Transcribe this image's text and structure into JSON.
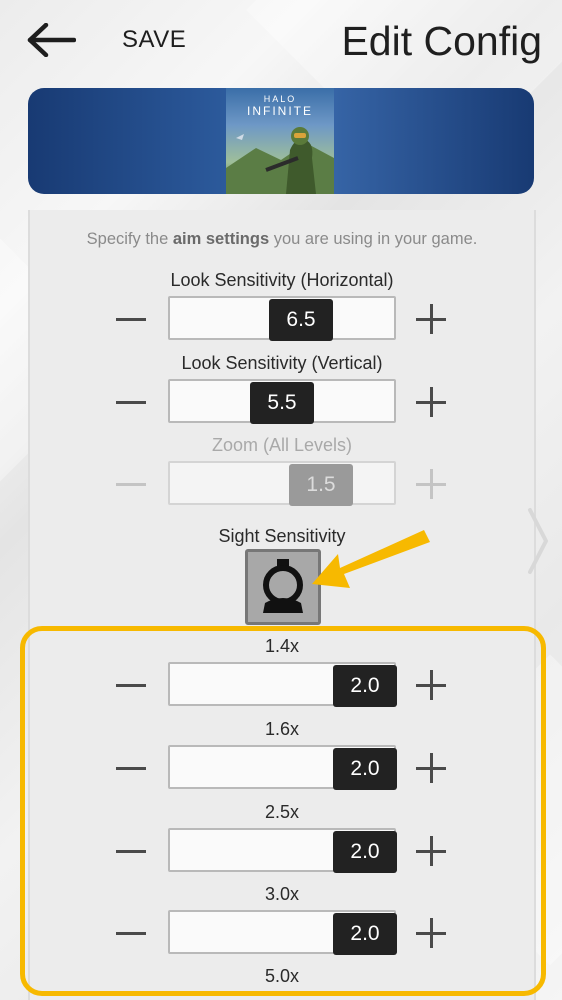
{
  "header": {
    "save_label": "SAVE",
    "title": "Edit Config"
  },
  "banner": {
    "cover_logo": "HALO",
    "cover_subtitle": "INFINITE"
  },
  "panel": {
    "hint_prefix": "Specify the ",
    "hint_bold": "aim settings",
    "hint_suffix": " you are using in your game."
  },
  "settings": [
    {
      "label": "Look Sensitivity (Horizontal)",
      "value": "6.5",
      "enabled": true
    },
    {
      "label": "Look Sensitivity (Vertical)",
      "value": "5.5",
      "enabled": true
    },
    {
      "label": "Zoom (All Levels)",
      "value": "1.5",
      "enabled": false
    }
  ],
  "sight": {
    "label": "Sight Sensitivity",
    "icon": "sight-scope-icon"
  },
  "zoom_levels": [
    {
      "label": "1.4x",
      "value": "2.0"
    },
    {
      "label": "1.6x",
      "value": "2.0"
    },
    {
      "label": "2.5x",
      "value": "2.0"
    },
    {
      "label": "3.0x",
      "value": "2.0"
    },
    {
      "label": "5.0x"
    }
  ],
  "colors": {
    "highlight": "#f7b900",
    "thumb": "#222222",
    "banner": "#2f5fa2"
  }
}
